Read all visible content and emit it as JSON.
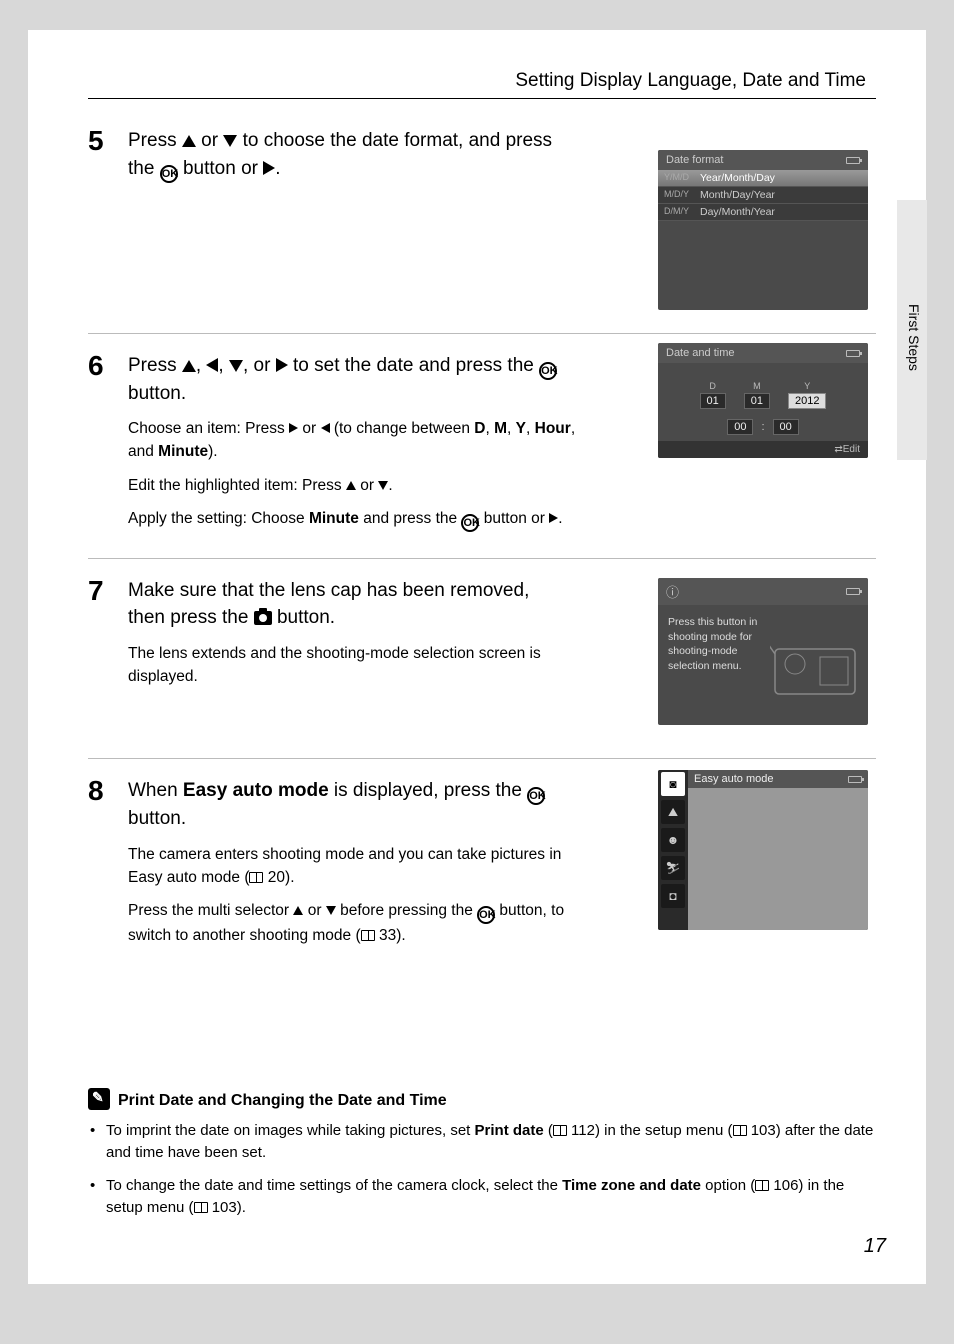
{
  "header": {
    "title": "Setting Display Language, Date and Time"
  },
  "side_tab": "First Steps",
  "page_number": "17",
  "steps": {
    "s5": {
      "num": "5",
      "main_a": "Press ",
      "main_b": " or ",
      "main_c": " to choose the date format, and press the ",
      "main_d": " button or ",
      "main_e": "."
    },
    "s6": {
      "num": "6",
      "main_a": "Press ",
      "main_b": ", ",
      "main_c": ", ",
      "main_d": ", or ",
      "main_e": " to set the date and press the ",
      "main_f": " button.",
      "sub1_a": "Choose an item: Press ",
      "sub1_b": " or ",
      "sub1_c": " (to change between ",
      "sub1_d": "D",
      "sub1_e": ", ",
      "sub1_f": "M",
      "sub1_g": ", ",
      "sub1_h": "Y",
      "sub1_i": ", ",
      "sub1_j": "Hour",
      "sub1_k": ", and ",
      "sub1_l": "Minute",
      "sub1_m": ").",
      "sub2_a": "Edit the highlighted item: Press ",
      "sub2_b": " or ",
      "sub2_c": ".",
      "sub3_a": "Apply the setting: Choose ",
      "sub3_b": "Minute",
      "sub3_c": " and press the ",
      "sub3_d": " button or ",
      "sub3_e": "."
    },
    "s7": {
      "num": "7",
      "main_a": "Make sure that the lens cap has been removed, then press the ",
      "main_b": " button.",
      "sub1": "The lens extends and the shooting-mode selection screen is displayed."
    },
    "s8": {
      "num": "8",
      "main_a": "When ",
      "main_b": "Easy auto mode",
      "main_c": " is displayed, press the ",
      "main_d": " button.",
      "sub1_a": "The camera enters shooting mode and you can take pictures in Easy auto mode (",
      "sub1_b": " 20).",
      "sub2_a": "Press the multi selector ",
      "sub2_b": " or ",
      "sub2_c": " before pressing the ",
      "sub2_d": " button, to switch to another shooting mode (",
      "sub2_e": " 33)."
    }
  },
  "screens": {
    "df": {
      "title": "Date format",
      "rows": [
        {
          "code": "Y/M/D",
          "label": "Year/Month/Day"
        },
        {
          "code": "M/D/Y",
          "label": "Month/Day/Year"
        },
        {
          "code": "D/M/Y",
          "label": "Day/Month/Year"
        }
      ]
    },
    "dt": {
      "title": "Date and time",
      "d_lbl": "D",
      "m_lbl": "M",
      "y_lbl": "Y",
      "d_val": "01",
      "m_val": "01",
      "y_val": "2012",
      "h_val": "00",
      "min_val": "00",
      "colon": ":",
      "edit": "Edit"
    },
    "info": {
      "text": "Press this button in shooting mode for shooting-mode selection menu."
    },
    "mode": {
      "title": "Easy auto mode"
    }
  },
  "notes": {
    "title": "Print Date and Changing the Date and Time",
    "n1_a": "To imprint the date on images while taking pictures, set ",
    "n1_b": "Print date",
    "n1_c": " (",
    "n1_d": " 112) in the setup menu (",
    "n1_e": " 103) after the date and time have been set.",
    "n2_a": "To change the date and time settings of the camera clock, select the ",
    "n2_b": "Time zone and date",
    "n2_c": " option (",
    "n2_d": " 106) in the setup menu (",
    "n2_e": " 103)."
  },
  "ok_text": "OK"
}
